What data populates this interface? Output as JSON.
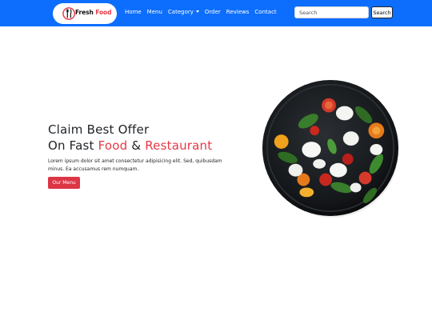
{
  "brand": {
    "name_part1": "Fresh",
    "name_part2": "Food"
  },
  "nav": {
    "items": [
      {
        "label": "Home"
      },
      {
        "label": "Menu"
      },
      {
        "label": "Category"
      },
      {
        "label": "Order"
      },
      {
        "label": "Reviews"
      },
      {
        "label": "Contact"
      }
    ]
  },
  "search": {
    "placeholder": "Search",
    "button_label": "Search"
  },
  "hero": {
    "line1": "Claim Best Offer",
    "line2_prefix": "On Fast",
    "line2_food": "Food",
    "line2_amp": "&",
    "line2_restaurant": "Restaurant",
    "description": "Lorem ipsum dolor sit amet consectetur adipisicing elit. Sed, quibusdam minus. Ea accusamus rem numquam.",
    "cta_label": "Our Menu"
  },
  "colors": {
    "navbar": "#0d6efd",
    "accent": "#e63946",
    "button": "#dc3545"
  }
}
